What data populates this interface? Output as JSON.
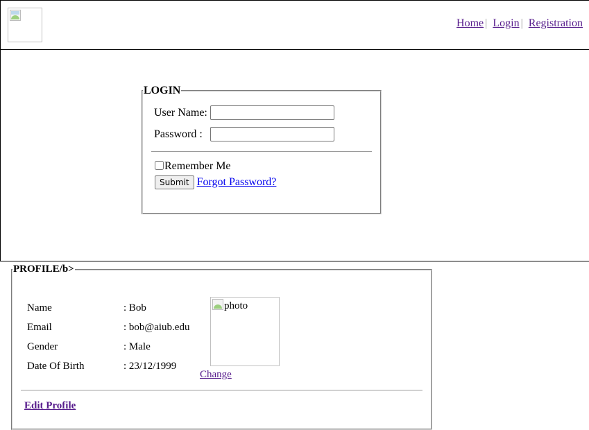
{
  "header": {
    "logo_alt": "",
    "nav": [
      {
        "label": "Home"
      },
      {
        "label": "Login"
      },
      {
        "label": "Registration"
      }
    ],
    "separator": "|"
  },
  "login": {
    "legend": "LOGIN",
    "username_label": "User Name:",
    "username_value": "",
    "password_label": "Password :",
    "password_value": "",
    "remember_label": "Remember Me",
    "remember_checked": false,
    "submit_label": "Submit",
    "forgot_link": "Forgot Password?"
  },
  "profile": {
    "legend": "PROFILE/b>",
    "fields": [
      {
        "label": "Name",
        "value": ": Bob"
      },
      {
        "label": "Email",
        "value": ": bob@aiub.edu"
      },
      {
        "label": "Gender",
        "value": ": Male"
      },
      {
        "label": "Date Of Birth",
        "value": ": 23/12/1999"
      }
    ],
    "photo_alt": "photo",
    "change_link": "Change",
    "edit_link": "Edit Profile"
  },
  "colors": {
    "link": "#0000ee",
    "visited_link": "#551a8b",
    "border": "#000000"
  },
  "icons": {
    "logo": "broken-image-icon",
    "photo": "broken-image-icon"
  }
}
